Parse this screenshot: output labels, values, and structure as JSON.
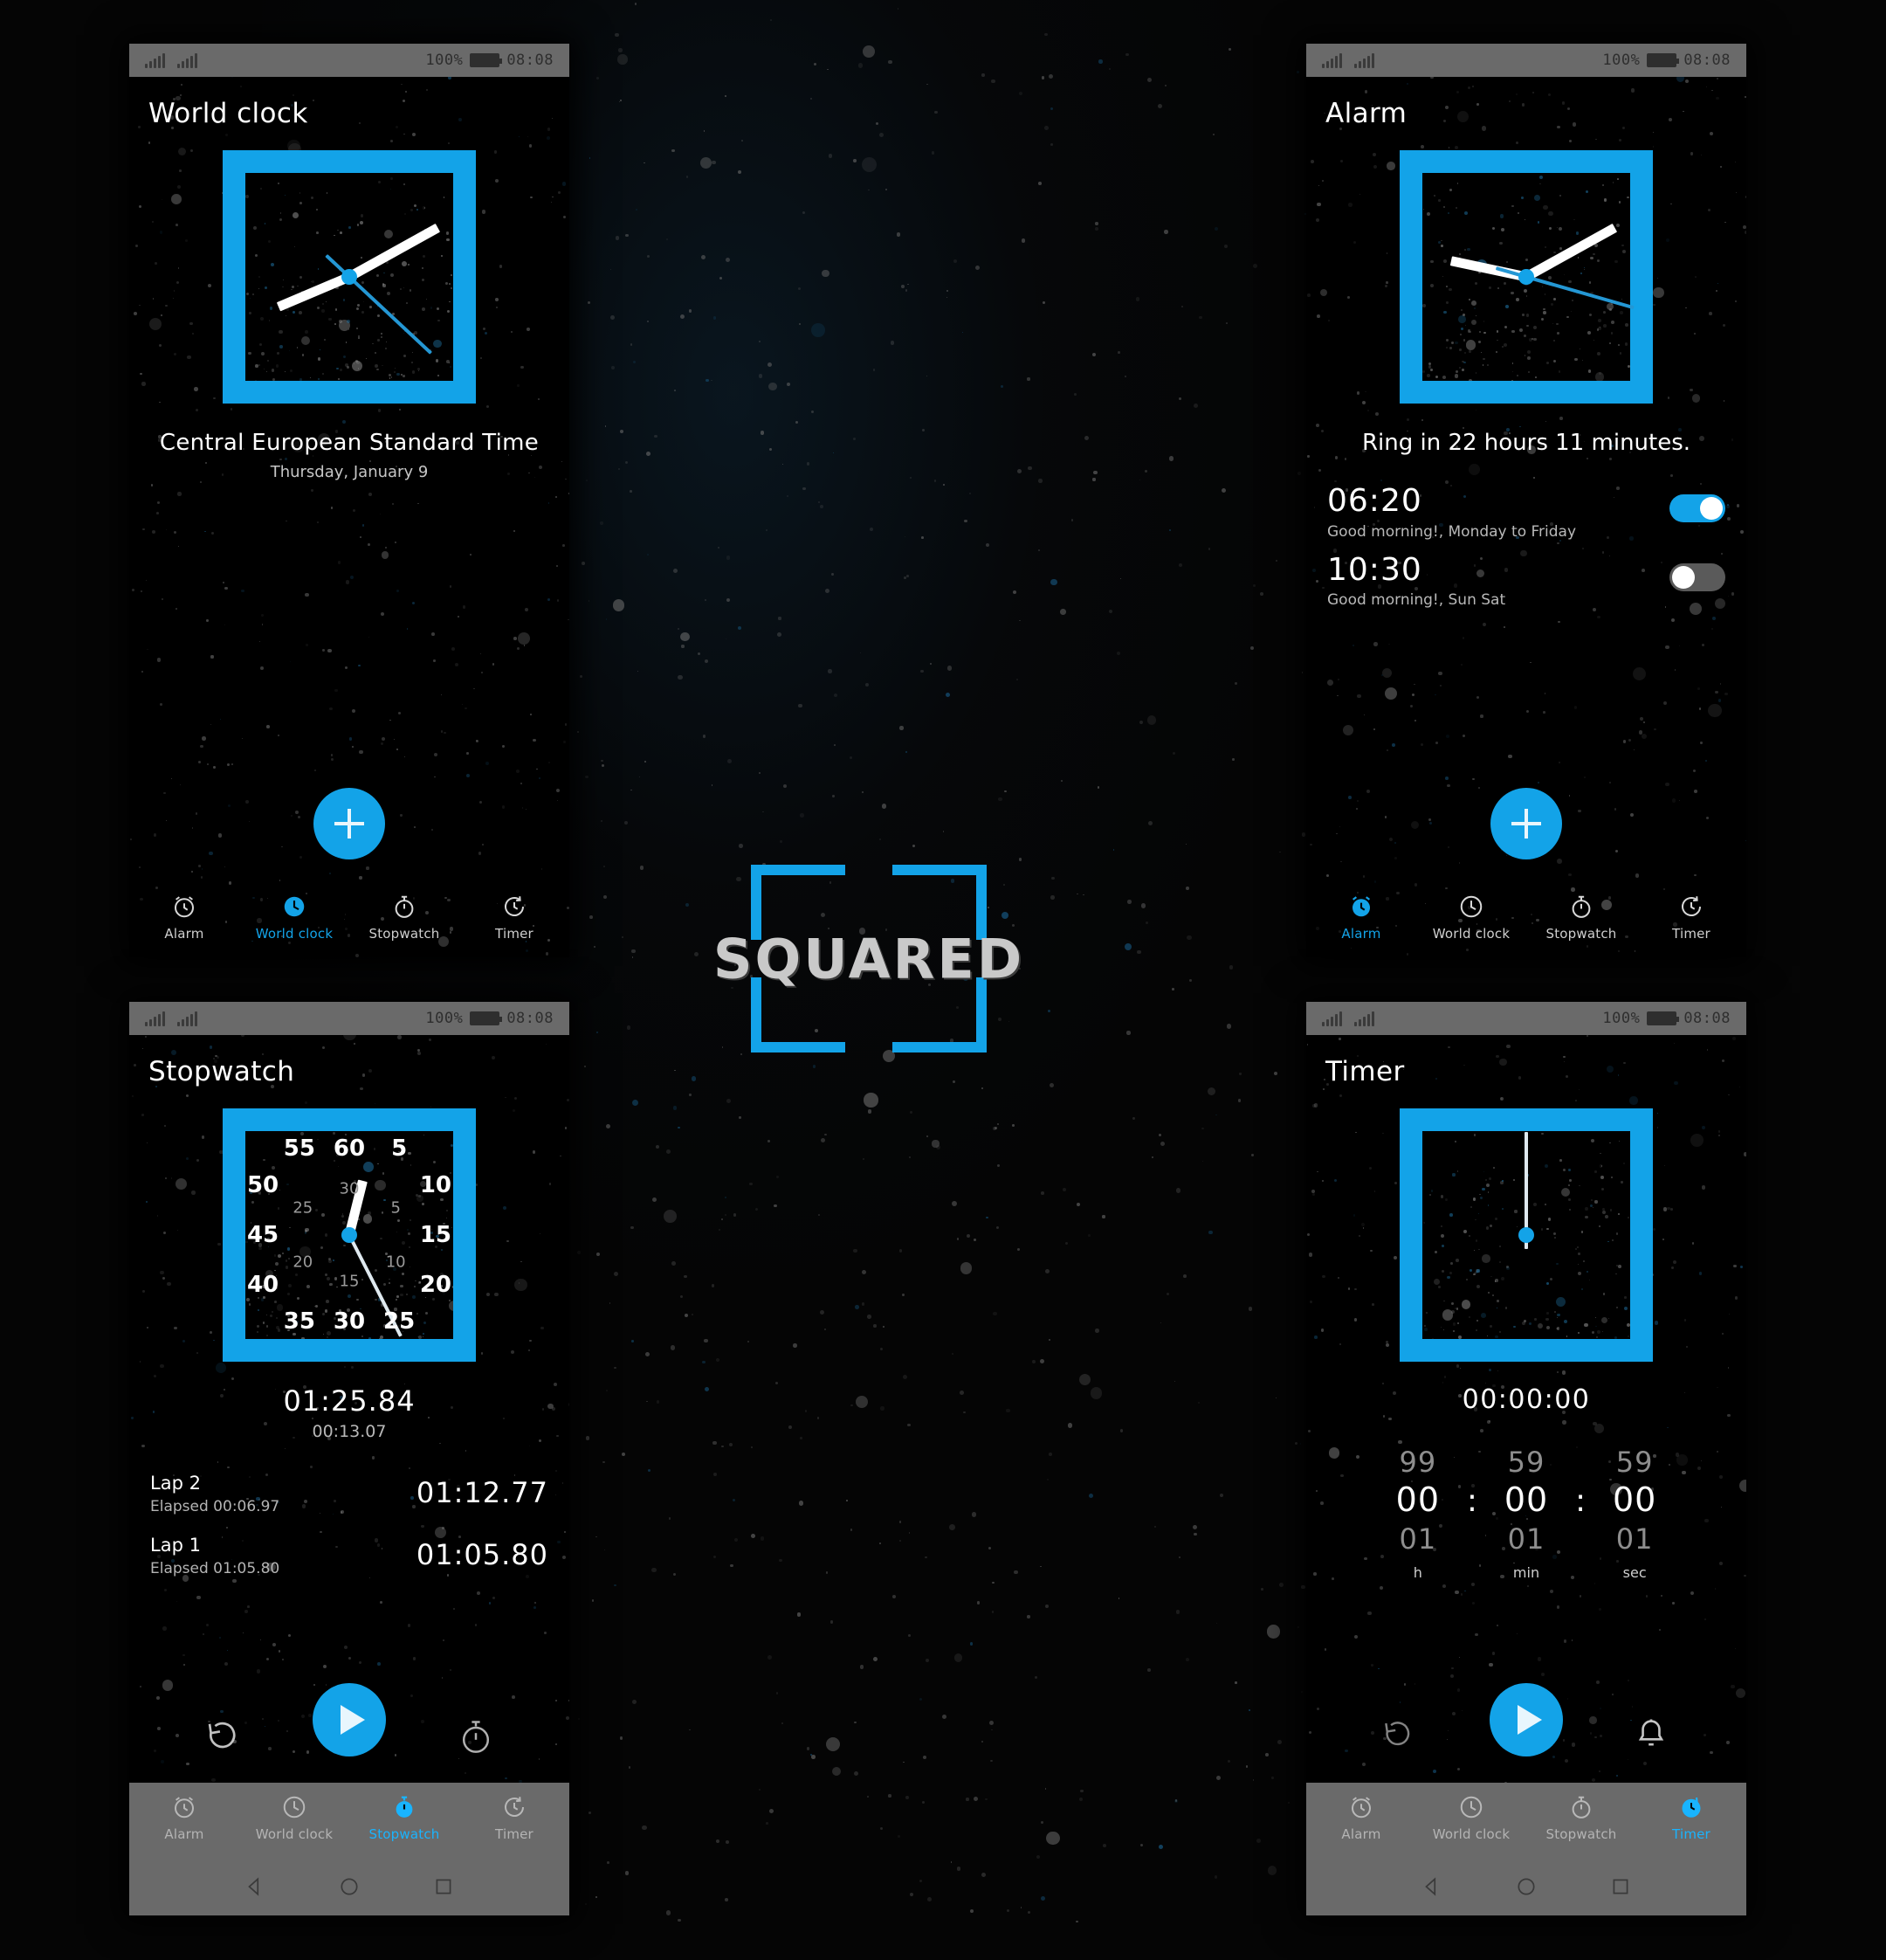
{
  "brand": {
    "name": "SQUARED",
    "accent": "#13a3e8"
  },
  "status_bar": {
    "battery_percent": "100%",
    "time": "08:08"
  },
  "tabs": [
    {
      "label": "Alarm",
      "icon": "alarm-clock-icon"
    },
    {
      "label": "World clock",
      "icon": "clock-icon"
    },
    {
      "label": "Stopwatch",
      "icon": "stopwatch-icon"
    },
    {
      "label": "Timer",
      "icon": "timer-icon"
    }
  ],
  "world_clock": {
    "title": "World clock",
    "timezone": "Central European Standard Time",
    "date": "Thursday, January 9",
    "add_label": "+",
    "active_tab": "World clock"
  },
  "alarm": {
    "title": "Alarm",
    "ring_in": "Ring in 22 hours 11 minutes.",
    "items": [
      {
        "time": "06:20",
        "description": "Good morning!, Monday to Friday",
        "enabled": "on"
      },
      {
        "time": "10:30",
        "description": "Good morning!, Sun Sat",
        "enabled": "off"
      }
    ],
    "add_label": "+",
    "active_tab": "Alarm"
  },
  "stopwatch": {
    "title": "Stopwatch",
    "total": "01:25.84",
    "current_lap": "00:13.07",
    "laps": [
      {
        "name": "Lap 2",
        "elapsed_label": "Elapsed 00:06.97",
        "total": "01:12.77"
      },
      {
        "name": "Lap 1",
        "elapsed_label": "Elapsed 01:05.80",
        "total": "01:05.80"
      }
    ],
    "dial_outer": [
      "60",
      "5",
      "10",
      "15",
      "20",
      "25",
      "30",
      "35",
      "40",
      "45",
      "50",
      "55"
    ],
    "dial_inner": [
      "30",
      "5",
      "10",
      "15",
      "20",
      "25"
    ],
    "reset_icon": "reset-icon",
    "play_icon": "play-icon",
    "lap_icon": "lap-timer-icon",
    "active_tab": "Stopwatch"
  },
  "timer": {
    "title": "Timer",
    "display": "00:00:00",
    "picker": [
      {
        "up": "99",
        "current": "00",
        "down": "01",
        "unit": "h"
      },
      {
        "up": "59",
        "current": "00",
        "down": "01",
        "unit": "min"
      },
      {
        "up": "59",
        "current": "00",
        "down": "01",
        "unit": "sec"
      }
    ],
    "separator": ":",
    "reset_icon": "reset-icon",
    "play_icon": "play-icon",
    "bell_icon": "bell-icon",
    "active_tab": "Timer"
  },
  "android_nav": {
    "back": "back-triangle-icon",
    "home": "home-circle-icon",
    "recents": "recents-square-icon"
  }
}
